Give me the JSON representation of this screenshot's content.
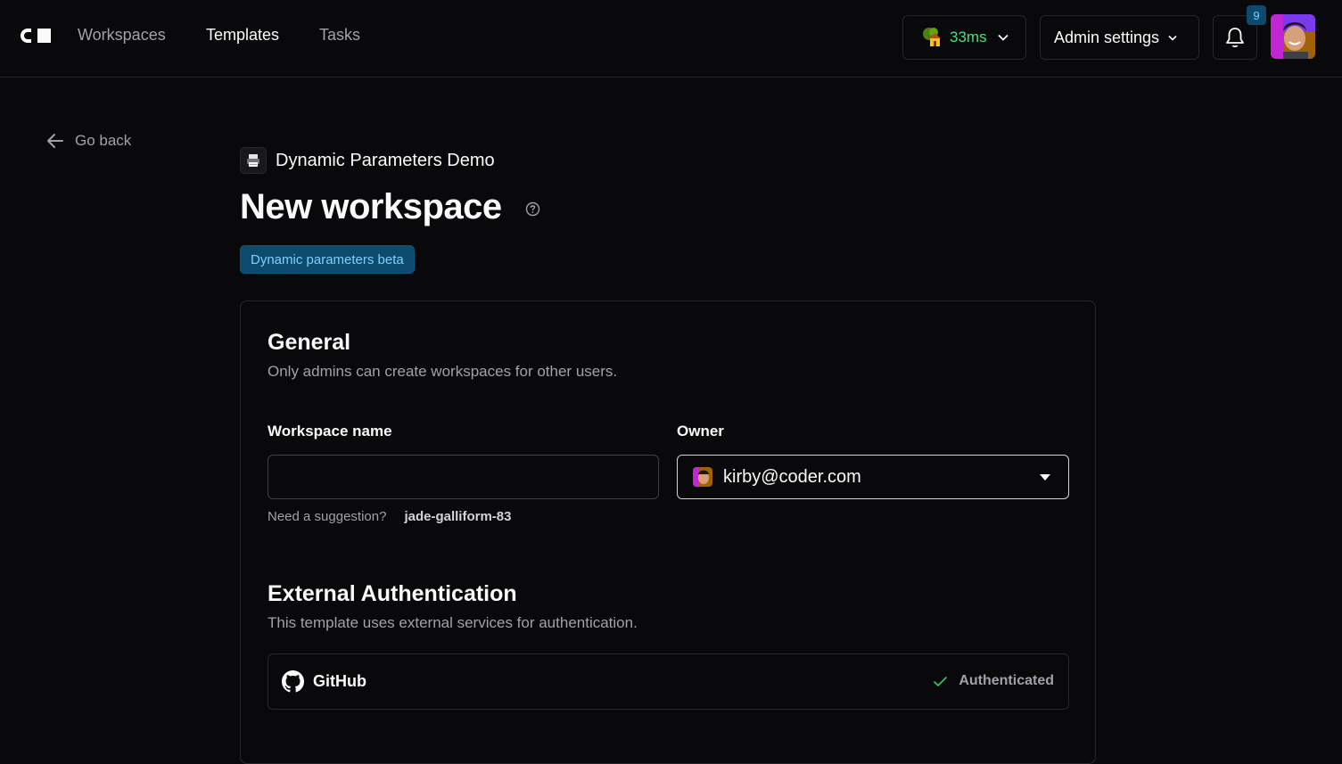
{
  "nav": {
    "links": [
      "Workspaces",
      "Templates",
      "Tasks"
    ],
    "latency": "33ms",
    "admin_settings": "Admin settings",
    "notification_count": "9"
  },
  "back": {
    "label": "Go back"
  },
  "header": {
    "template_name": "Dynamic Parameters Demo",
    "title": "New workspace",
    "beta_badge": "Dynamic parameters beta"
  },
  "general": {
    "title": "General",
    "description": "Only admins can create workspaces for other users.",
    "workspace_name_label": "Workspace name",
    "workspace_name_value": "",
    "suggestion_prompt": "Need a suggestion?",
    "suggestion_value": "jade-galliform-83",
    "owner_label": "Owner",
    "owner_value": "kirby@coder.com"
  },
  "external_auth": {
    "title": "External Authentication",
    "description": "This template uses external services for authentication.",
    "providers": [
      {
        "name": "GitHub",
        "status": "Authenticated"
      }
    ]
  },
  "colors": {
    "background": "#09090b",
    "border": "#27272a",
    "latency_green": "#4ade80",
    "badge_bg": "#0c4a6e",
    "badge_text": "#7dd3fc",
    "success_check": "#22c55e"
  }
}
